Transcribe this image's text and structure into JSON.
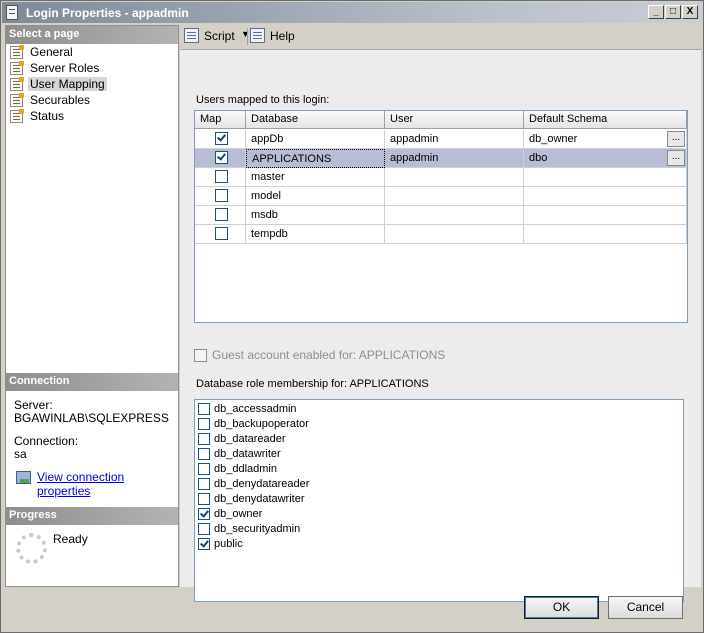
{
  "window": {
    "title": "Login Properties - appadmin",
    "min": "_",
    "max": "□",
    "close": "X"
  },
  "left": {
    "select_header": "Select a page",
    "pages": [
      "General",
      "Server Roles",
      "User Mapping",
      "Securables",
      "Status"
    ],
    "selected_page": "User Mapping",
    "connection_header": "Connection",
    "server_label": "Server:",
    "server_value": "BGAWINLAB\\SQLEXPRESS",
    "connection_label": "Connection:",
    "connection_value": "sa",
    "view_link": "View connection properties",
    "progress_header": "Progress",
    "progress_status": "Ready"
  },
  "toolbar": {
    "script_label": "Script",
    "help_label": "Help",
    "caret": "▼"
  },
  "mapping": {
    "label": "Users mapped to this login:",
    "columns": [
      "Map",
      "Database",
      "User",
      "Default Schema"
    ],
    "rows": [
      {
        "map": true,
        "database": "appDb",
        "user": "appadmin",
        "schema": "db_owner",
        "selected": false,
        "has_button": true
      },
      {
        "map": true,
        "database": "APPLICATIONS",
        "user": "appadmin",
        "schema": "dbo",
        "selected": true,
        "has_button": true
      },
      {
        "map": false,
        "database": "master",
        "user": "",
        "schema": "",
        "selected": false,
        "has_button": false
      },
      {
        "map": false,
        "database": "model",
        "user": "",
        "schema": "",
        "selected": false,
        "has_button": false
      },
      {
        "map": false,
        "database": "msdb",
        "user": "",
        "schema": "",
        "selected": false,
        "has_button": false
      },
      {
        "map": false,
        "database": "tempdb",
        "user": "",
        "schema": "",
        "selected": false,
        "has_button": false
      }
    ],
    "ellipsis": "..."
  },
  "guest": {
    "label": "Guest account enabled for: APPLICATIONS",
    "checked": false,
    "enabled": false
  },
  "roles": {
    "label": "Database role membership for: APPLICATIONS",
    "items": [
      {
        "name": "db_accessadmin",
        "checked": false
      },
      {
        "name": "db_backupoperator",
        "checked": false
      },
      {
        "name": "db_datareader",
        "checked": false
      },
      {
        "name": "db_datawriter",
        "checked": false
      },
      {
        "name": "db_ddladmin",
        "checked": false
      },
      {
        "name": "db_denydatareader",
        "checked": false
      },
      {
        "name": "db_denydatawriter",
        "checked": false
      },
      {
        "name": "db_owner",
        "checked": true
      },
      {
        "name": "db_securityadmin",
        "checked": false
      },
      {
        "name": "public",
        "checked": true
      }
    ]
  },
  "buttons": {
    "ok": "OK",
    "cancel": "Cancel"
  }
}
